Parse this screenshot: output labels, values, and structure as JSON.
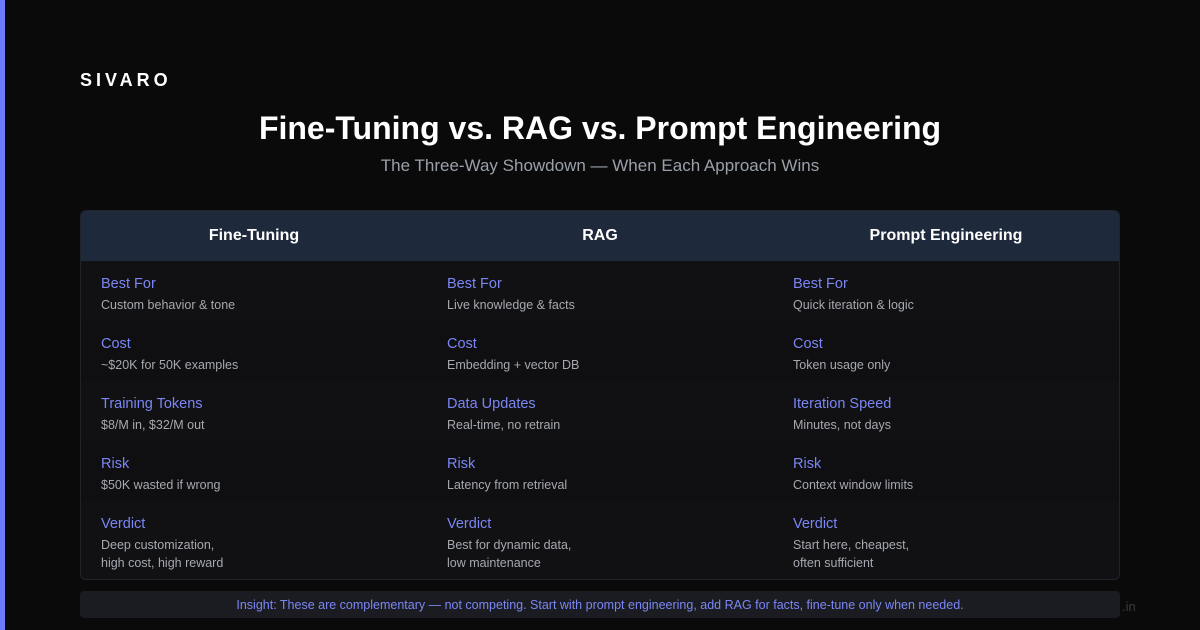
{
  "brand": "SIVARO",
  "title": "Fine-Tuning vs. RAG vs. Prompt Engineering",
  "subtitle": "The Three-Way Showdown — When Each Approach Wins",
  "columns": [
    {
      "header": "Fine-Tuning",
      "rows": [
        {
          "label": "Best For",
          "value": "Custom behavior & tone"
        },
        {
          "label": "Cost",
          "value": "~$20K for 50K examples"
        },
        {
          "label": "Training Tokens",
          "value": "$8/M in, $32/M out"
        },
        {
          "label": "Risk",
          "value": "$50K wasted if wrong"
        },
        {
          "label": "Verdict",
          "value": "Deep customization,",
          "value2": "high cost, high reward"
        }
      ]
    },
    {
      "header": "RAG",
      "rows": [
        {
          "label": "Best For",
          "value": "Live knowledge & facts"
        },
        {
          "label": "Cost",
          "value": "Embedding + vector DB"
        },
        {
          "label": "Data Updates",
          "value": "Real-time, no retrain"
        },
        {
          "label": "Risk",
          "value": "Latency from retrieval"
        },
        {
          "label": "Verdict",
          "value": "Best for dynamic data,",
          "value2": "low maintenance"
        }
      ]
    },
    {
      "header": "Prompt Engineering",
      "rows": [
        {
          "label": "Best For",
          "value": "Quick iteration & logic"
        },
        {
          "label": "Cost",
          "value": "Token usage only"
        },
        {
          "label": "Iteration Speed",
          "value": "Minutes, not days"
        },
        {
          "label": "Risk",
          "value": "Context window limits"
        },
        {
          "label": "Verdict",
          "value": "Start here, cheapest,",
          "value2": "often sufficient"
        }
      ]
    }
  ],
  "insight": "Insight: These are complementary — not competing. Start with prompt engineering, add RAG for facts, fine-tune only when needed.",
  "watermark": ".in",
  "colors": {
    "accent": "#6b7cff",
    "header_bg": "#1e293b",
    "label": "#7b86f5",
    "background": "#0a0a0b"
  }
}
